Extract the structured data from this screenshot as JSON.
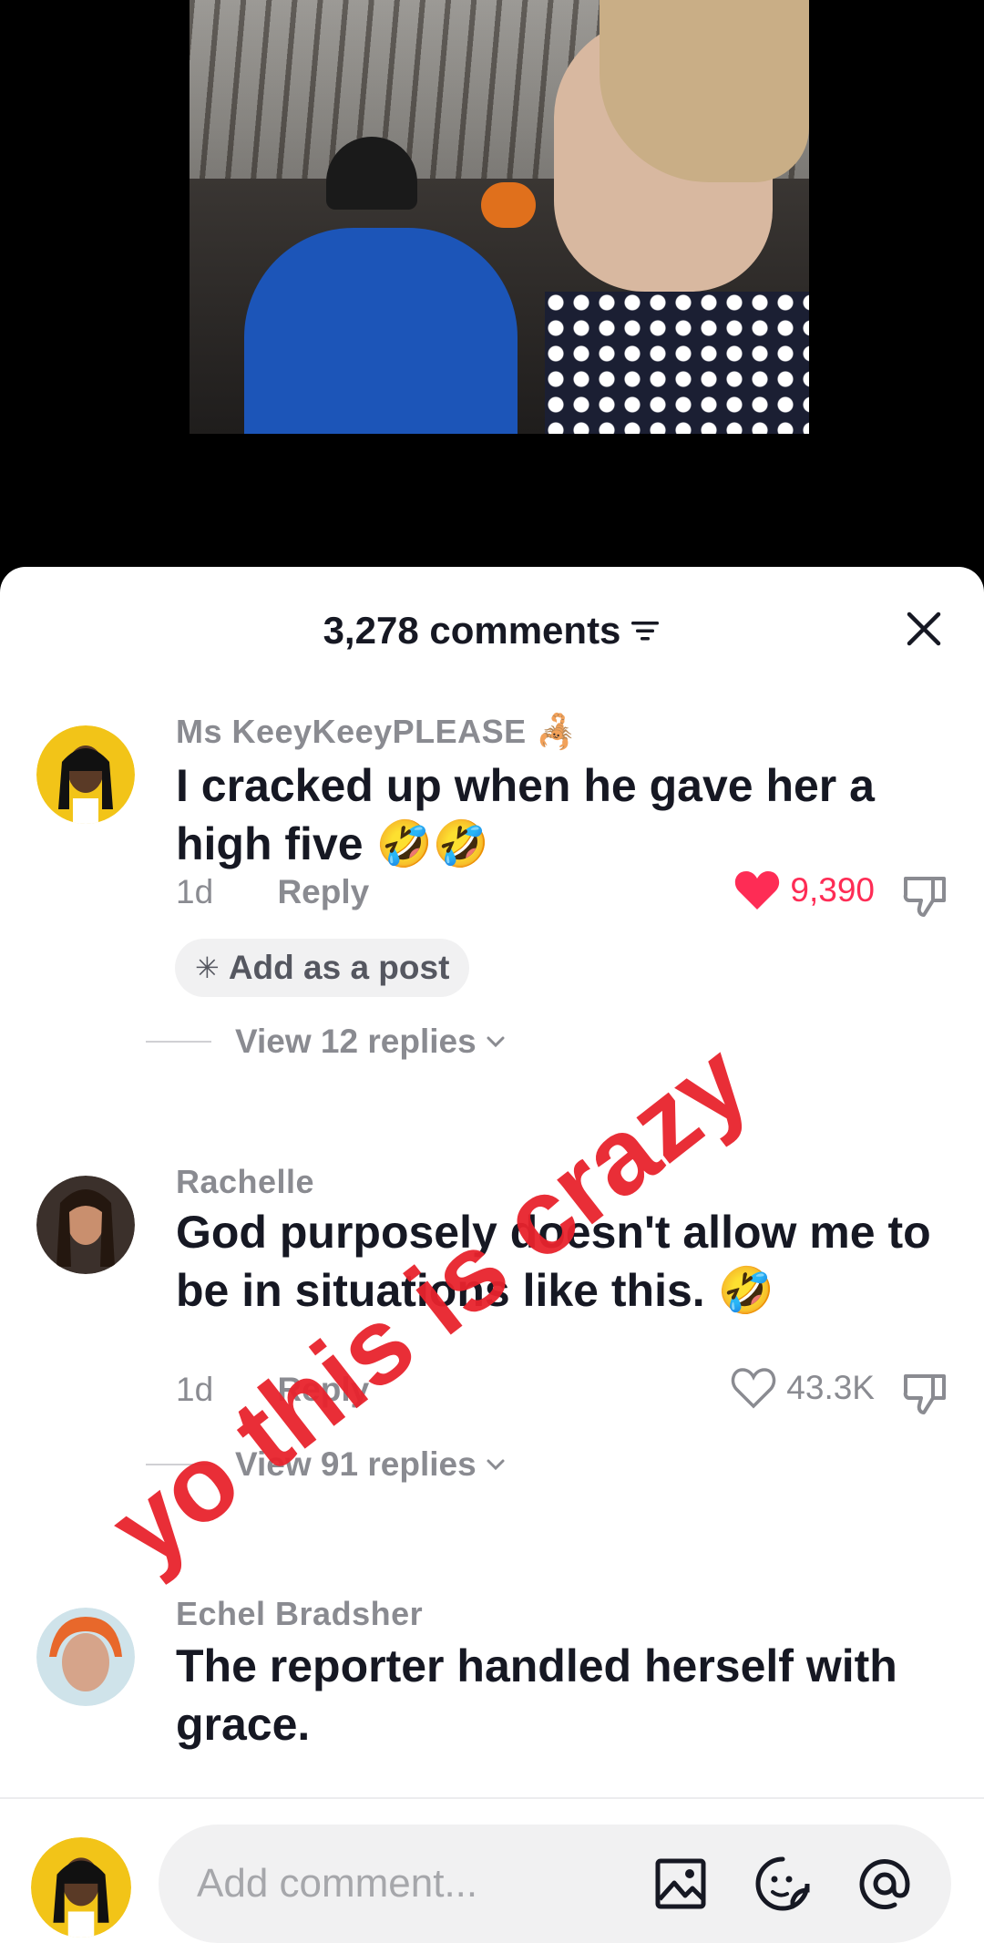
{
  "sheet": {
    "comment_count": "3,278 comments"
  },
  "comments": [
    {
      "username": "Ms  KeeyKeeyPLEASE 🦂",
      "text": "I cracked up when he gave her a high five 🤣🤣",
      "time": "1d",
      "reply_label": "Reply",
      "likes": "9,390",
      "liked": true,
      "add_post_label": "Add as a post",
      "view_replies": "View 12 replies"
    },
    {
      "username": "Rachelle",
      "text": "God purposely doesn't allow me to be in situations like this. 🤣",
      "time": "1d",
      "reply_label": "Reply",
      "likes": "43.3K",
      "liked": false,
      "view_replies": "View 91 replies"
    },
    {
      "username": "Echel Bradsher",
      "text": "The reporter handled herself with grace."
    }
  ],
  "input": {
    "placeholder": "Add comment..."
  },
  "overlay": {
    "text": "yo this is crazy"
  },
  "colors": {
    "like_active": "#fe2c55",
    "overlay": "#e8232d",
    "secondary_text": "#8a8b91"
  }
}
